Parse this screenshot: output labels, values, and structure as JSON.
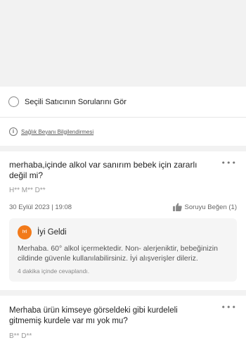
{
  "filter": {
    "label": "Seçili Satıcının Sorularını Gör"
  },
  "health_notice": {
    "icon_symbol": "i",
    "link_text": "Sağlık Beyanı Bilgilendirmesi"
  },
  "question_1": {
    "text": "merhaba,içinde alkol var sanırım bebek için zararlı değil mi?",
    "more_symbol": "•••",
    "user_mask": "H** M** D**",
    "date": "30 Eylül 2023 | 19:08",
    "like_label": "Soruyu Beğen (1)",
    "answer": {
      "logo_text": "İYİ GELDİ",
      "seller_name": "İyi Geldi",
      "text": "Merhaba. 60° alkol içermektedir. Non- alerjeniktir, bebeğinizin cildinde güvenle kullanılabilirsiniz. İyi alışverişler dileriz.",
      "answered_in": "4 dakika içinde cevaplandı."
    }
  },
  "question_2": {
    "text": "Merhaba ürün kimseye görseldeki gibi kurdeleli gitmemiş kurdele var mı yok mu?",
    "more_symbol": "•••",
    "user_mask": "B** D**"
  },
  "colors": {
    "brand_orange": "#f27a1a",
    "background": "#f2f2f2",
    "answer_bg": "#f5f5f5"
  }
}
